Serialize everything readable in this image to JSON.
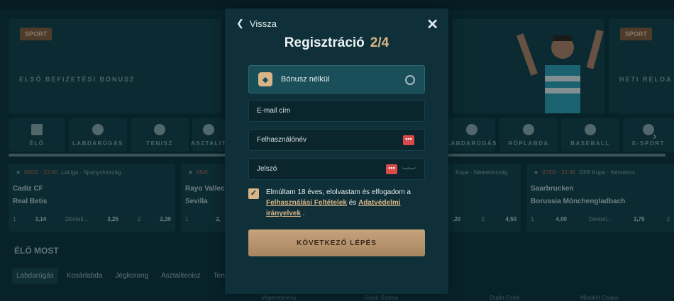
{
  "background": {
    "banners": [
      {
        "tag": "SPORT",
        "title": "ELSŐ BEFIZETÉSI BÓNUSZ"
      },
      {
        "tag": "SPORT",
        "title": "HETI RELOA"
      }
    ],
    "sport_tabs": [
      "ÉLŐ",
      "LABDARÚGÁS",
      "TENISZ",
      "ASZTALIT",
      "LABDARÚGÁS",
      "RÖPLABDA",
      "BASEBALL",
      "E-SPORT"
    ],
    "matches": [
      {
        "date": "09/02 · 22:00",
        "league": "LaLiga · Spanyolország",
        "team1": "Cadiz CF",
        "team2": "Real Betis",
        "o1": "3,14",
        "ox_label": "Döntetl...",
        "ox": "3,25",
        "o2_label": "2",
        "o2": "2,30",
        "o1_label": "1"
      },
      {
        "date": "05/0",
        "league": "",
        "team1": "Rayo Vallec",
        "team2": "Sevilla",
        "o1": "2,",
        "ox_label": "",
        "ox": "",
        "o2_label": "",
        "o2": "",
        "o1_label": "1"
      },
      {
        "date": "",
        "league": "Kupa · Németország",
        "team1": "",
        "team2": "",
        "o1": "",
        "ox_label": "",
        "ox": ",20",
        "o2_label": "2",
        "o2": "4,50",
        "o1_label": ""
      },
      {
        "date": "07/02 · 21:45",
        "league": "DFB Kupa · Németors",
        "team1": "Saarbrucken",
        "team2": "Borussia Mönchengladbach",
        "o1": "4,00",
        "ox_label": "Döntetl...",
        "ox": "3,75",
        "o2_label": "2",
        "o2": "",
        "o1_label": "1"
      }
    ],
    "live_heading": "ÉLŐ MOST",
    "live_tabs": [
      "Labdarúgás",
      "Kosárlabda",
      "Jégkorong",
      "Asztalitenisz",
      "Teni"
    ],
    "bottom": [
      "Végeredmény",
      "Gólok Száma",
      "Dupla Esély",
      "Mindkét Csapa"
    ]
  },
  "modal": {
    "back_label": "Vissza",
    "title": "Regisztráció",
    "step": "2/4",
    "bonus_label": "Bónusz nélkül",
    "email_placeholder": "E-mail cím",
    "username_placeholder": "Felhasználónév",
    "password_placeholder": "Jelszó",
    "consent_prefix": "Elmúltam 18 éves, elolvastam és elfogadom a",
    "terms_link": "Felhasználási Feltételek",
    "and": "és",
    "privacy_link": "Adatvédelmi irányelvek",
    "period": ".",
    "next_button": "KÖVETKEZŐ LÉPÉS",
    "accent": "#d9b487"
  }
}
